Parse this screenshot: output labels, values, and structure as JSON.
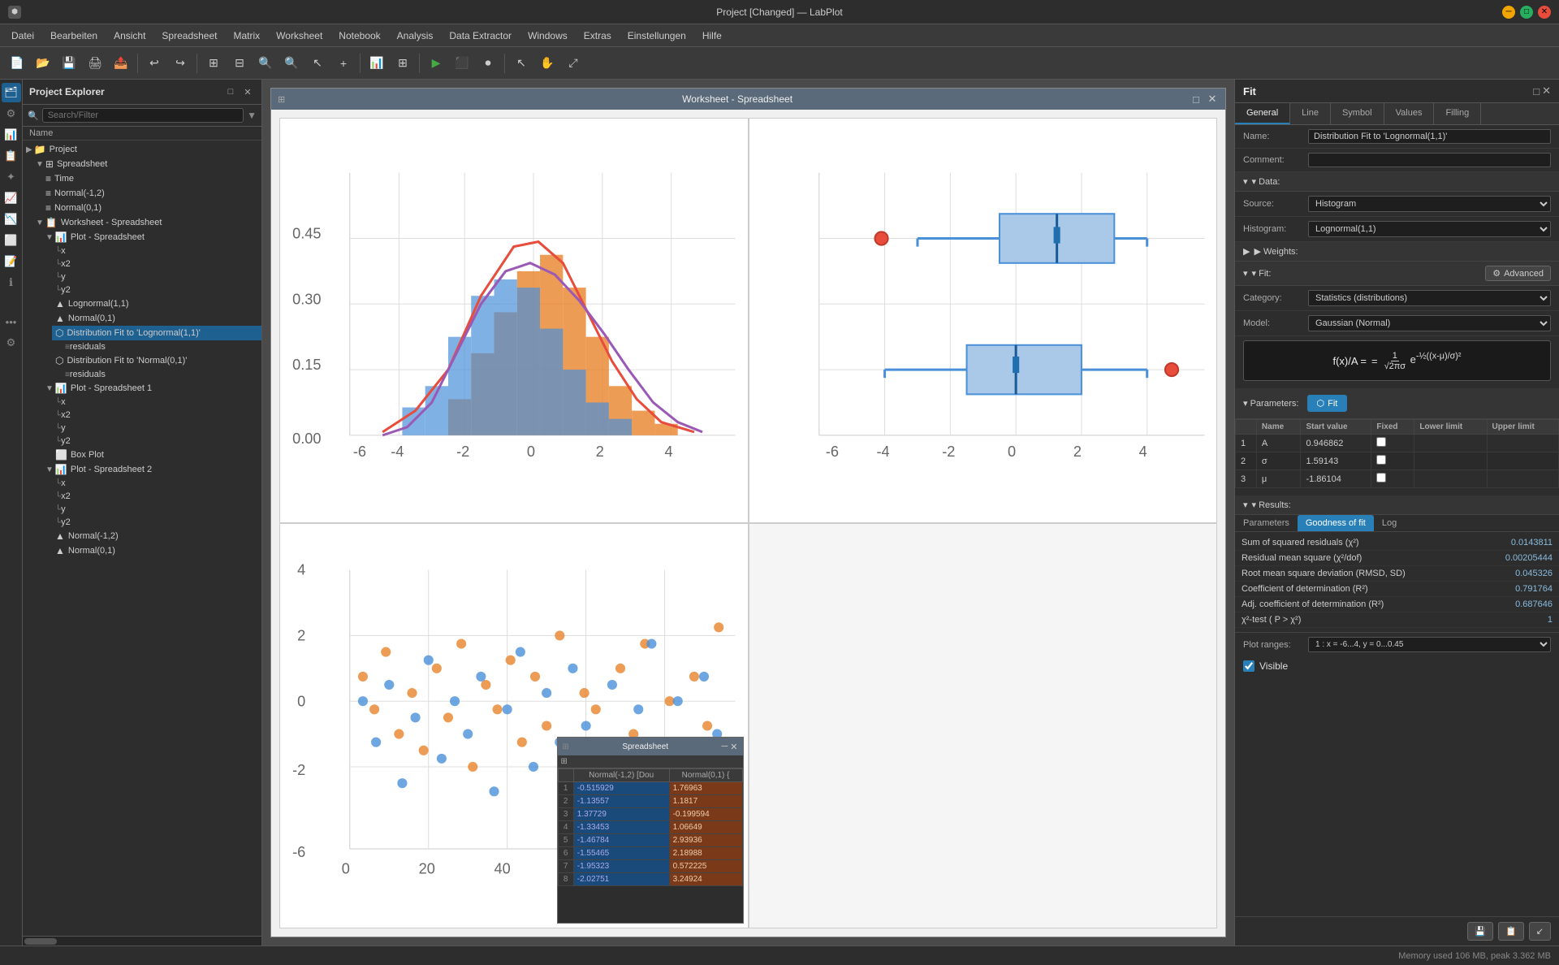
{
  "titlebar": {
    "title": "Project [Changed] — LabPlot",
    "min": "—",
    "max": "□",
    "close": "✕"
  },
  "menu": {
    "items": [
      "Datei",
      "Bearbeiten",
      "Ansicht",
      "Spreadsheet",
      "Matrix",
      "Worksheet",
      "Notebook",
      "Analysis",
      "Data Extractor",
      "Windows",
      "Extras",
      "Einstellungen",
      "Hilfe"
    ]
  },
  "sidebar": {
    "title": "Project Explorer",
    "search_placeholder": "Search/Filter",
    "col_name": "Name",
    "tree": [
      {
        "label": "Project",
        "indent": 0,
        "type": "folder",
        "icon": "▶"
      },
      {
        "label": "Spreadsheet",
        "indent": 1,
        "type": "spreadsheet",
        "icon": "▼"
      },
      {
        "label": "Time",
        "indent": 2,
        "type": "col",
        "icon": "≡"
      },
      {
        "label": "Normal(-1,2)",
        "indent": 2,
        "type": "col",
        "icon": "≡"
      },
      {
        "label": "Normal(0,1)",
        "indent": 2,
        "type": "col",
        "icon": "≡"
      },
      {
        "label": "Worksheet - Spreadsheet",
        "indent": 1,
        "type": "worksheet",
        "icon": "▼"
      },
      {
        "label": "Plot - Spreadsheet",
        "indent": 2,
        "type": "plot",
        "icon": "▼"
      },
      {
        "label": "x",
        "indent": 3,
        "type": "axis"
      },
      {
        "label": "x2",
        "indent": 3,
        "type": "axis"
      },
      {
        "label": "y",
        "indent": 3,
        "type": "axis"
      },
      {
        "label": "y2",
        "indent": 3,
        "type": "axis"
      },
      {
        "label": "Lognormal(1,1)",
        "indent": 3,
        "type": "dist"
      },
      {
        "label": "Normal(0,1)",
        "indent": 3,
        "type": "dist"
      },
      {
        "label": "Distribution Fit to 'Lognormal(1,1)'",
        "indent": 3,
        "type": "fit",
        "selected": true
      },
      {
        "label": "residuals",
        "indent": 4,
        "type": "residuals"
      },
      {
        "label": "Distribution Fit to 'Normal(0,1)'",
        "indent": 3,
        "type": "fit"
      },
      {
        "label": "residuals",
        "indent": 4,
        "type": "residuals"
      },
      {
        "label": "Plot - Spreadsheet 1",
        "indent": 2,
        "type": "plot",
        "icon": "▼"
      },
      {
        "label": "x",
        "indent": 3,
        "type": "axis"
      },
      {
        "label": "x2",
        "indent": 3,
        "type": "axis"
      },
      {
        "label": "y",
        "indent": 3,
        "type": "axis"
      },
      {
        "label": "y2",
        "indent": 3,
        "type": "axis"
      },
      {
        "label": "Box Plot",
        "indent": 3,
        "type": "boxplot"
      },
      {
        "label": "Plot - Spreadsheet 2",
        "indent": 2,
        "type": "plot",
        "icon": "▼"
      },
      {
        "label": "x",
        "indent": 3,
        "type": "axis"
      },
      {
        "label": "x2",
        "indent": 3,
        "type": "axis"
      },
      {
        "label": "y",
        "indent": 3,
        "type": "axis"
      },
      {
        "label": "y2",
        "indent": 3,
        "type": "axis"
      },
      {
        "label": "Normal(-1,2)",
        "indent": 3,
        "type": "dist"
      },
      {
        "label": "Normal(0,1)",
        "indent": 3,
        "type": "dist"
      }
    ]
  },
  "worksheet_window": {
    "title": "Worksheet - Spreadsheet",
    "icon": "□"
  },
  "spreadsheet_window": {
    "title": "Spreadsheet",
    "col1": "Normal(-1,2) [Dou",
    "col2": "Normal(0,1) {",
    "rows": [
      {
        "num": 1,
        "v1": "-0.515929",
        "v2": "1.76963"
      },
      {
        "num": 2,
        "v1": "-1.13557",
        "v2": "1.1817"
      },
      {
        "num": 3,
        "v1": "1.37729",
        "v2": "-0.199594"
      },
      {
        "num": 4,
        "v1": "-1.33453",
        "v2": "1.06649"
      },
      {
        "num": 5,
        "v1": "-1.46784",
        "v2": "2.93936"
      },
      {
        "num": 6,
        "v1": "-1.55465",
        "v2": "2.18988"
      },
      {
        "num": 7,
        "v1": "-1.95323",
        "v2": "0.572225"
      },
      {
        "num": 8,
        "v1": "-2.02751",
        "v2": "3.24924"
      }
    ]
  },
  "right_panel": {
    "title": "Fit",
    "tabs": [
      "General",
      "Line",
      "Symbol",
      "Values",
      "Filling"
    ],
    "active_tab": "General",
    "fields": {
      "name_label": "Name:",
      "name_value": "Distribution Fit to 'Lognormal(1,1)'",
      "comment_label": "Comment:",
      "comment_value": ""
    },
    "data_section": {
      "label": "▾ Data:",
      "source_label": "Source:",
      "source_value": "Histogram",
      "histogram_label": "Histogram:",
      "histogram_value": "Lognormal(1,1)"
    },
    "weights_section": {
      "label": "▶ Weights:"
    },
    "fit_section": {
      "label": "▾ Fit:",
      "advanced_label": "Advanced",
      "category_label": "Category:",
      "category_value": "Statistics (distributions)",
      "model_label": "Model:",
      "model_value": "Gaussian (Normal)",
      "formula_label": "f(x)/A =",
      "formula": "1/(√(2πσ)) · e^(-½((x-μ)/σ)²)"
    },
    "parameters": {
      "section_label": "▾ Parameters:",
      "headers": [
        "Name",
        "Start value",
        "Fixed",
        "Lower limit",
        "Upper limit"
      ],
      "rows": [
        {
          "num": 1,
          "name": "A",
          "start": "0.946862",
          "fixed": false
        },
        {
          "num": 2,
          "name": "σ",
          "start": "1.59143",
          "fixed": false
        },
        {
          "num": 3,
          "name": "μ",
          "start": "-1.86104",
          "fixed": false
        }
      ],
      "fit_btn": "Fit"
    },
    "results": {
      "section_label": "▾ Results:",
      "tabs": [
        "Parameters",
        "Goodness of fit",
        "Log"
      ],
      "active_tab": "Goodness of fit",
      "rows": [
        {
          "label": "Sum of squared residuals (χ²)",
          "value": "0.0143811"
        },
        {
          "label": "Residual mean square (χ²/dof)",
          "value": "0.00205444"
        },
        {
          "label": "Root mean square deviation (RMSD, SD)",
          "value": "0.045326"
        },
        {
          "label": "Coefficient of determination (R²)",
          "value": "0.791764"
        },
        {
          "label": "Adj. coefficient of determination (R²)",
          "value": "0.687646"
        },
        {
          "label": "χ²-test ( P > χ²)",
          "value": "1"
        }
      ]
    },
    "plot_ranges": {
      "label": "Plot ranges:",
      "value": "1 : x = -6...4, y = 0...0.45"
    },
    "visible_label": "Visible",
    "visible_checked": true,
    "bottom_btns": [
      "💾",
      "📋",
      "↙"
    ]
  },
  "status_bar": {
    "text": "Memory used 106 MB, peak 3.362 MB"
  }
}
